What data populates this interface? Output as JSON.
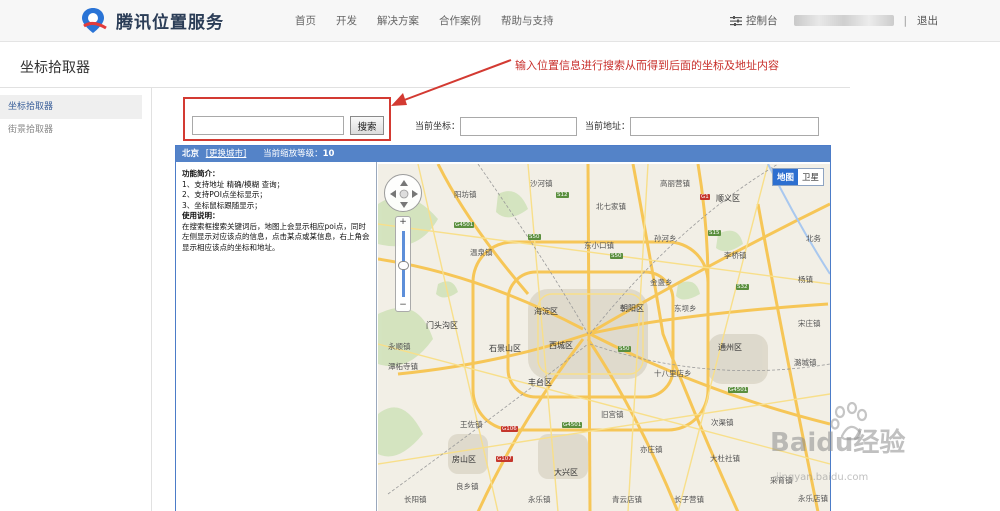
{
  "brand": {
    "name": "腾讯位置服务"
  },
  "nav": {
    "items": [
      "首页",
      "开发",
      "解决方案",
      "合作案例",
      "帮助与支持"
    ]
  },
  "header_right": {
    "console": "控制台",
    "separator": "|",
    "logout": "退出"
  },
  "page": {
    "title": "坐标拾取器"
  },
  "annotation": {
    "text": "输入位置信息进行搜索从而得到后面的坐标及地址内容",
    "color": "#c8302c"
  },
  "sidebar": {
    "items": [
      {
        "label": "坐标拾取器",
        "active": true
      },
      {
        "label": "街景拾取器",
        "active": false
      }
    ]
  },
  "search": {
    "value": "",
    "button_label": "搜索",
    "coord_label": "当前坐标：",
    "coord_value": "",
    "address_label": "当前地址：",
    "address_value": ""
  },
  "panel": {
    "city": "北京",
    "change_city": "[更换城市]",
    "zoom_label": "当前缩放等级：",
    "zoom_value": "10",
    "accent": "#5483c8"
  },
  "info": {
    "features_title": "功能简介：",
    "features": [
      "1、支持地址 精确/模糊 查询；",
      "2、支持POI点坐标显示；",
      "3、坐标鼠标跟随显示；"
    ],
    "usage_title": "使用说明：",
    "usage_text": "在搜索框搜索关键词后，地图上会显示相应poi点，同时左侧显示对应该点的信息，点击某点或某信息，右上角会显示相应该点的坐标和地址。"
  },
  "map": {
    "type_options": [
      "地图",
      "卫星"
    ],
    "selected_type": "地图",
    "zoom_plus": "+",
    "zoom_minus": "−",
    "zoom_level_fraction": 0.45,
    "places": [
      "沙河镇",
      "高丽营镇",
      "阳坊镇",
      "北七家镇",
      "顺义区",
      "北务",
      "东小口镇",
      "孙河乡",
      "温泉镇",
      "李桥镇",
      "金盏乡",
      "杨镇",
      "海淀区",
      "朝阳区",
      "东坝乡",
      "门头沟区",
      "宋庄镇",
      "永顺镇",
      "石景山区",
      "西城区",
      "通州区",
      "潞城镇",
      "潭柘寺镇",
      "丰台区",
      "十八里店乡",
      "旧宫镇",
      "王佐镇",
      "次渠镇",
      "大杜社镇",
      "房山区",
      "大兴区",
      "采育镇",
      "良乡镇",
      "长阳镇",
      "亦庄镇",
      "永乐店镇",
      "永乐镇",
      "长子营镇",
      "青云店镇"
    ],
    "road_shields": [
      "G4501",
      "S50",
      "S12",
      "G4501",
      "S50",
      "G1",
      "G106",
      "S15",
      "S32",
      "G107",
      "S50",
      "G4501"
    ]
  },
  "watermark": {
    "brand": "Baidu经验",
    "url": "jingyan.baidu.com"
  }
}
